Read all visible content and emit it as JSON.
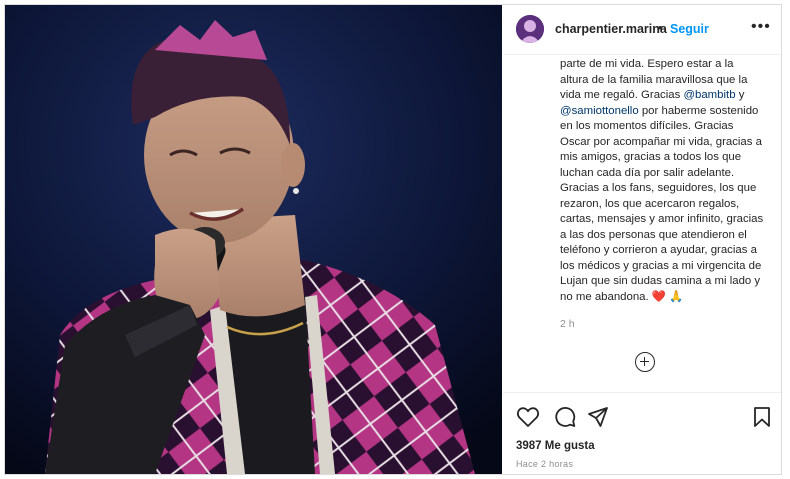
{
  "post": {
    "photo_alt": "photo",
    "username": "charpentier.marina",
    "separator": "•",
    "follow_label": "Seguir",
    "more_label": "•••",
    "caption": {
      "part1": "parte de mi vida. Espero estar a la altura de la familia maravillosa que la vida me regaló. Gracias ",
      "mention1": "@bambitb",
      "part2": " y ",
      "mention2": "@samiottonello",
      "part3": " por haberme sostenido en los momentos difíciles. Gracias Oscar por acompañar mi vida, gracias a mis amigos, gracias a todos los que luchan cada día por salir adelante. Gracias a los fans, seguidores, los que rezaron, los que acercaron regalos, cartas, mensajes y amor infinito, gracias a las dos personas que atendieron el teléfono y corrieron a ayudar, gracias a los médicos y gracias a mi virgencita de Lujan que sin dudas camina a mi lado y no me abandona. ❤️ 🙏"
    },
    "comment_time": "2 h",
    "likes": "3987 Me gusta",
    "posted_ago": "Hace 2 horas"
  },
  "icons": {
    "more": "more-options-icon",
    "like": "heart-icon",
    "comment": "comment-icon",
    "share": "share-icon",
    "save": "bookmark-icon",
    "add": "add-comment-icon"
  },
  "colors": {
    "follow": "#0095f6",
    "mention": "#00376b",
    "text": "#262626",
    "muted": "#8e8e8e",
    "jacket_pink": "#c23b8f",
    "background": "#0c1430"
  }
}
